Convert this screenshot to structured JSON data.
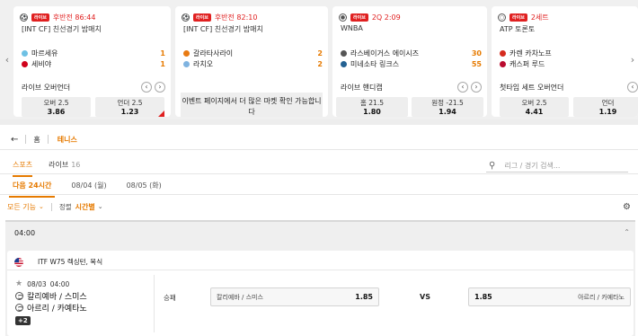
{
  "carousel": {
    "prev_icon": "chevron-left-icon",
    "next_icon": "chevron-right-icon",
    "live_badge": "라이브",
    "cards": [
      {
        "sport_icon": "soccer-ball-icon",
        "time": "후반전 86:44",
        "league": "[INT CF] 친선경기 밤매치",
        "team1": "마르세유",
        "score1": "1",
        "team1_color": "#6ec1e4",
        "team2": "세비야",
        "score2": "1",
        "team2_color": "#d0021b",
        "market": "라이브 오버언더",
        "odds": [
          {
            "label": "오버 2.5",
            "value": "3.86"
          },
          {
            "label": "언더 2.5",
            "value": "1.23"
          }
        ]
      },
      {
        "sport_icon": "soccer-ball-icon",
        "time": "후반전 82:10",
        "league": "[INT CF] 친선경기 밤매치",
        "team1": "갈라타사라이",
        "score1": "2",
        "team1_color": "#e87a12",
        "team2": "라치오",
        "score2": "2",
        "team2_color": "#7fb3e0",
        "message_line1": "이벤트 페이지에서 더 많은 마켓 확인 가능합니",
        "message_line2": "다"
      },
      {
        "sport_icon": "basketball-icon",
        "time": "2Q 2:09",
        "league": "WNBA",
        "team1": "라스베이거스 에이시즈",
        "score1": "30",
        "team1_color": "#555555",
        "team2": "미네소타 링크스",
        "score2": "55",
        "team2_color": "#236192",
        "market": "라이브 핸디캡",
        "odds": [
          {
            "label": "홈 21.5",
            "value": "1.80"
          },
          {
            "label": "원정 -21.5",
            "value": "1.94"
          }
        ]
      },
      {
        "sport_icon": "tennis-ball-icon",
        "time": "2세트",
        "league": "ATP 토론토",
        "team1": "카렌 카차노프",
        "score1": "",
        "team1_color": "#d52b1e",
        "team2": "캐스퍼 루드",
        "score2": "",
        "team2_color": "#ba0c2f",
        "market": "첫타임 세트 오버언더",
        "odds": [
          {
            "label": "오버 2.5",
            "value": "4.41"
          },
          {
            "label": "언더",
            "value": "1.19"
          }
        ]
      }
    ]
  },
  "breadcrumb": {
    "back_icon": "arrow-left-icon",
    "home": "홈",
    "current": "테니스"
  },
  "tabs": [
    {
      "label": "스포츠",
      "count": ""
    },
    {
      "label": "라이브",
      "count": "16"
    }
  ],
  "search": {
    "placeholder": "리그 / 경기 검색...",
    "icon": "search-icon"
  },
  "date_tabs": [
    "다음 24시간",
    "08/04 (월)",
    "08/05 (화)"
  ],
  "toolbar": {
    "all_functions": "모든 기능",
    "sort_label": "정렬",
    "sort_value": "시간별",
    "settings_icon": "gear-icon"
  },
  "time_group": "04:00",
  "event": {
    "league": "ITF W75 렉싱턴, 복식",
    "date": "08/03",
    "time": "04:00",
    "player1": "칼리예바 / 스미스",
    "player2": "아르리 / 카예타노",
    "more_markets": "+2",
    "market": "승패",
    "home": {
      "name": "칼리예바 / 스미스",
      "odds": "1.85"
    },
    "vs": "VS",
    "away": {
      "name": "아르리 / 카예타노",
      "odds": "1.85"
    }
  },
  "colors": {
    "accent": "#e67a00",
    "live": "#e02020"
  }
}
